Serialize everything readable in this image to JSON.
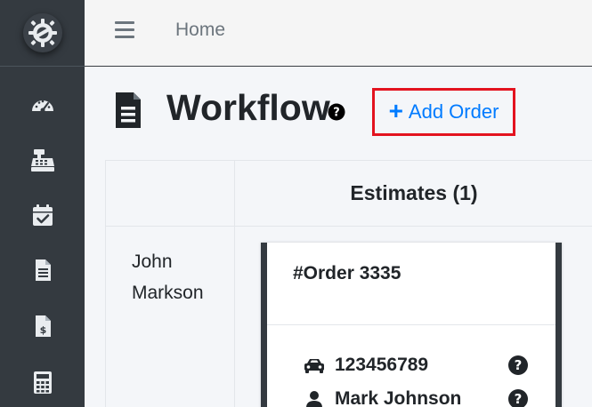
{
  "navbar": {
    "home_label": "Home"
  },
  "sidebar": {
    "items": [
      {
        "icon": "tachometer-icon"
      },
      {
        "icon": "cash-register-icon"
      },
      {
        "icon": "calendar-check-icon"
      },
      {
        "icon": "file-document-icon"
      },
      {
        "icon": "file-invoice-dollar-icon"
      },
      {
        "icon": "calculator-icon"
      }
    ]
  },
  "page": {
    "title": "Workflow",
    "add_order_label": "Add Order"
  },
  "board": {
    "columns": [
      {
        "label": "Estimates (1)"
      }
    ],
    "rows": [
      {
        "label": "John Markson",
        "card": {
          "title": "#Order 3335",
          "vehicle": "123456789",
          "person": "Mark Johnson"
        }
      }
    ]
  },
  "colors": {
    "sidebar_bg": "#343a40",
    "accent_blue": "#007bff",
    "highlight_red": "#e3131f"
  }
}
